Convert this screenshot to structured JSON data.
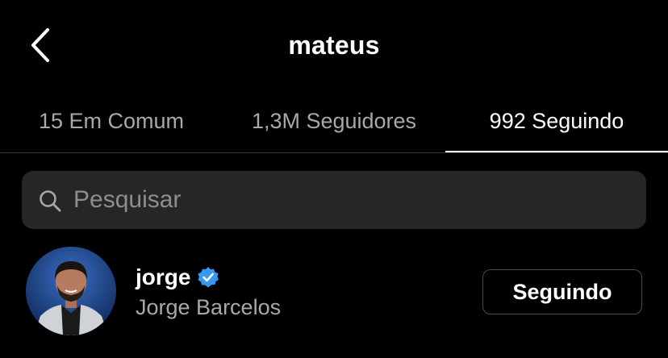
{
  "header": {
    "title": "mateus",
    "back_icon": "chevron-left-icon"
  },
  "tabs": [
    {
      "label": "15 Em Comum",
      "active": false
    },
    {
      "label": "1,3M Seguidores",
      "active": false
    },
    {
      "label": "992 Seguindo",
      "active": true
    }
  ],
  "search": {
    "placeholder": "Pesquisar",
    "value": "",
    "icon": "search-icon"
  },
  "users": [
    {
      "username": "jorge",
      "verified": true,
      "full_name": "Jorge Barcelos",
      "button_label": "Seguindo"
    }
  ],
  "colors": {
    "background": "#000000",
    "text_primary": "#ffffff",
    "text_secondary": "#a8a8a8",
    "search_bg": "#262626",
    "verified_badge": "#3897f0",
    "divider": "#363636"
  }
}
